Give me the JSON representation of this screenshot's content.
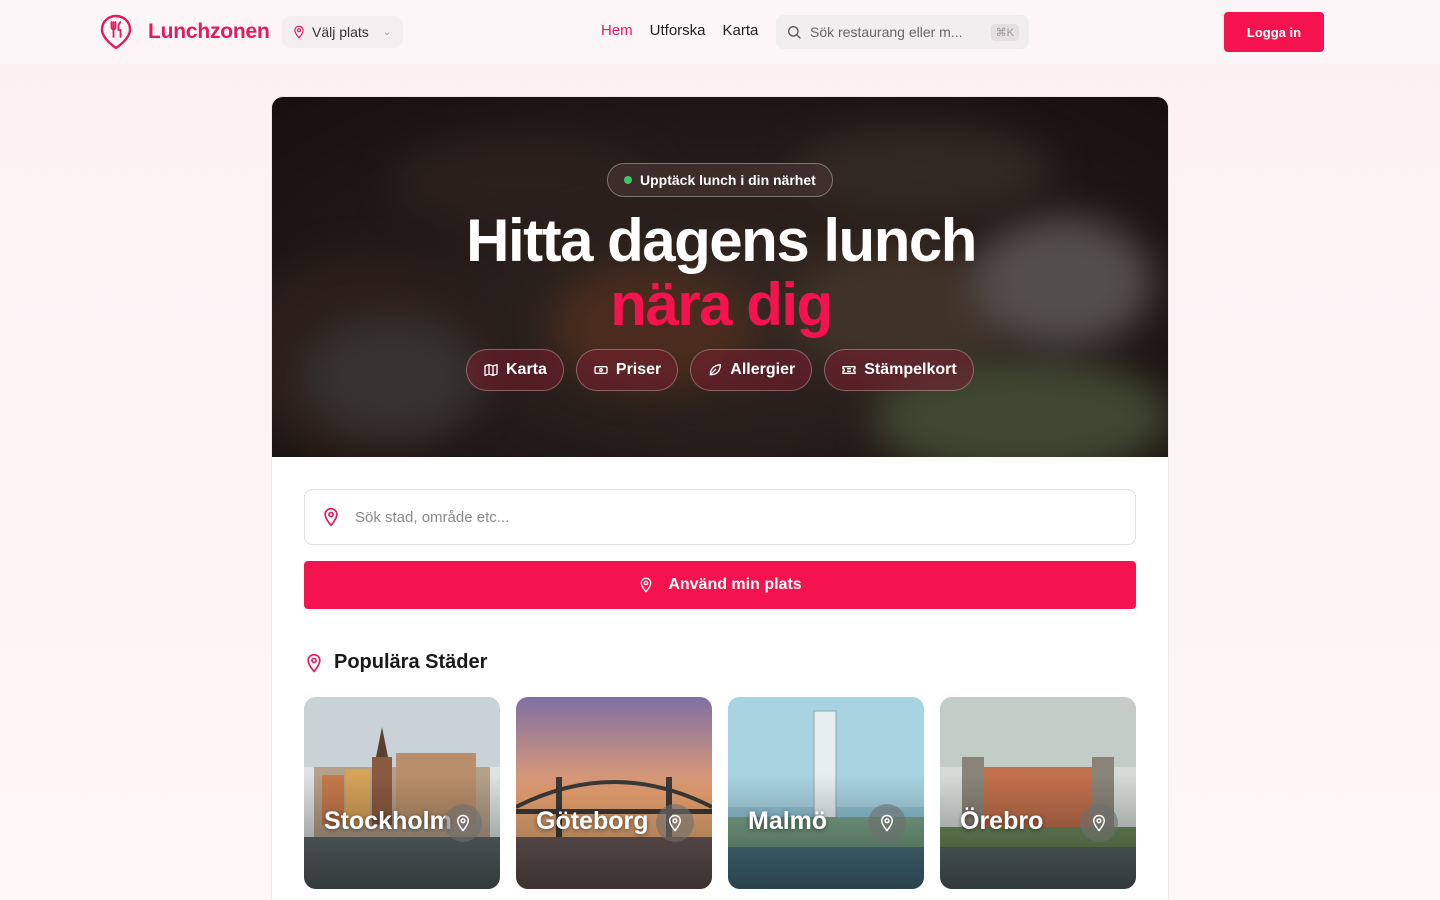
{
  "brand": {
    "name": "Lunchzonen",
    "accent": "#e8195a",
    "button": "#f5134f"
  },
  "header": {
    "place_label": "Välj plats",
    "nav": [
      {
        "label": "Hem",
        "active": true
      },
      {
        "label": "Utforska",
        "active": false
      },
      {
        "label": "Karta",
        "active": false
      }
    ],
    "search_placeholder": "Sök restaurang eller m...",
    "search_shortcut": "⌘K",
    "login_label": "Logga in"
  },
  "hero": {
    "badge": "Upptäck lunch i din närhet",
    "title_line1": "Hitta dagens lunch",
    "title_line2": "nära dig",
    "chips": [
      {
        "label": "Karta",
        "icon": "map-icon"
      },
      {
        "label": "Priser",
        "icon": "banknote-icon"
      },
      {
        "label": "Allergier",
        "icon": "leaf-icon"
      },
      {
        "label": "Stämpelkort",
        "icon": "ticket-icon"
      }
    ]
  },
  "search": {
    "placeholder": "Sök stad, område etc...",
    "use_location_label": "Använd min plats"
  },
  "popular": {
    "title": "Populära Städer",
    "cities": [
      {
        "name": "Stockholm"
      },
      {
        "name": "Göteborg"
      },
      {
        "name": "Malmö"
      },
      {
        "name": "Örebro"
      }
    ]
  }
}
